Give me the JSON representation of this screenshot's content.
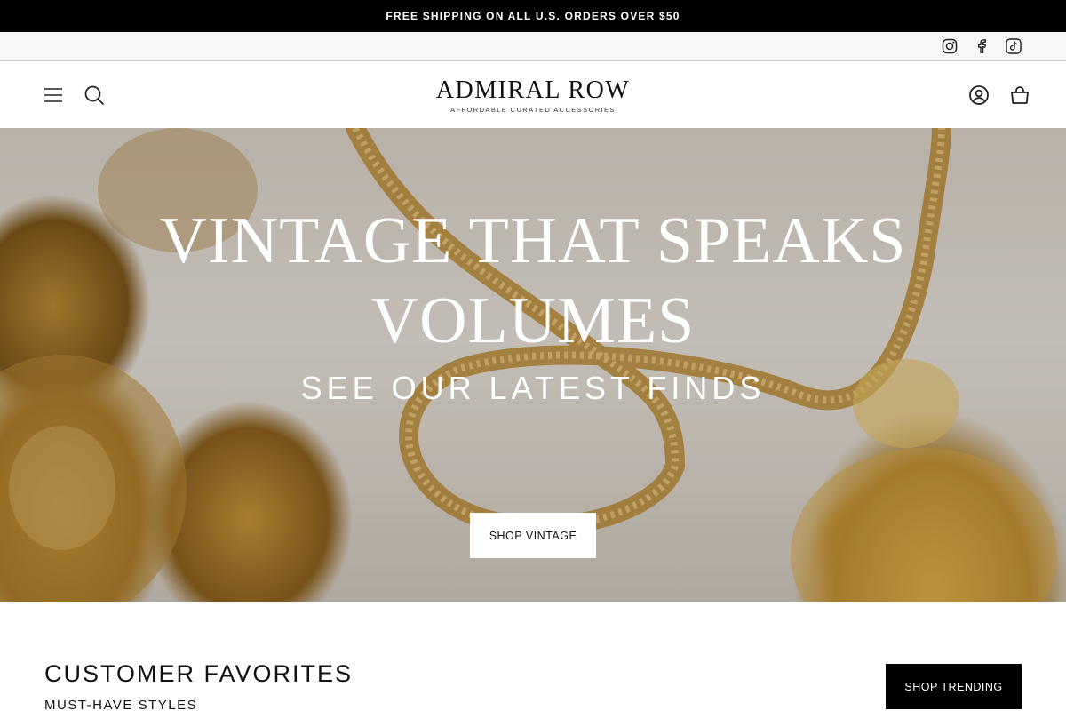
{
  "announcement": {
    "text": "FREE SHIPPING ON ALL U.S. ORDERS OVER $50"
  },
  "social": {
    "icons": [
      "instagram-icon",
      "facebook-icon",
      "tiktok-icon"
    ]
  },
  "header": {
    "logo_name": "ADMIRAL ROW",
    "logo_tagline": "AFFORDABLE CURATED ACCESSORIES",
    "left_icons": [
      "menu-icon",
      "search-icon"
    ],
    "right_icons": [
      "account-icon",
      "cart-icon"
    ]
  },
  "hero": {
    "headline_line1": "VINTAGE THAT SPEAKS",
    "headline_line2": "VOLUMES",
    "subheading": "SEE OUR LATEST FINDS",
    "button_label": "SHOP VINTAGE"
  },
  "favorites": {
    "title": "CUSTOMER FAVORITES",
    "subtitle": "MUST-HAVE STYLES",
    "button_label": "SHOP TRENDING"
  },
  "colors": {
    "bar": "#000000",
    "accent_gold": "#c99a3b",
    "background": "#ffffff"
  }
}
